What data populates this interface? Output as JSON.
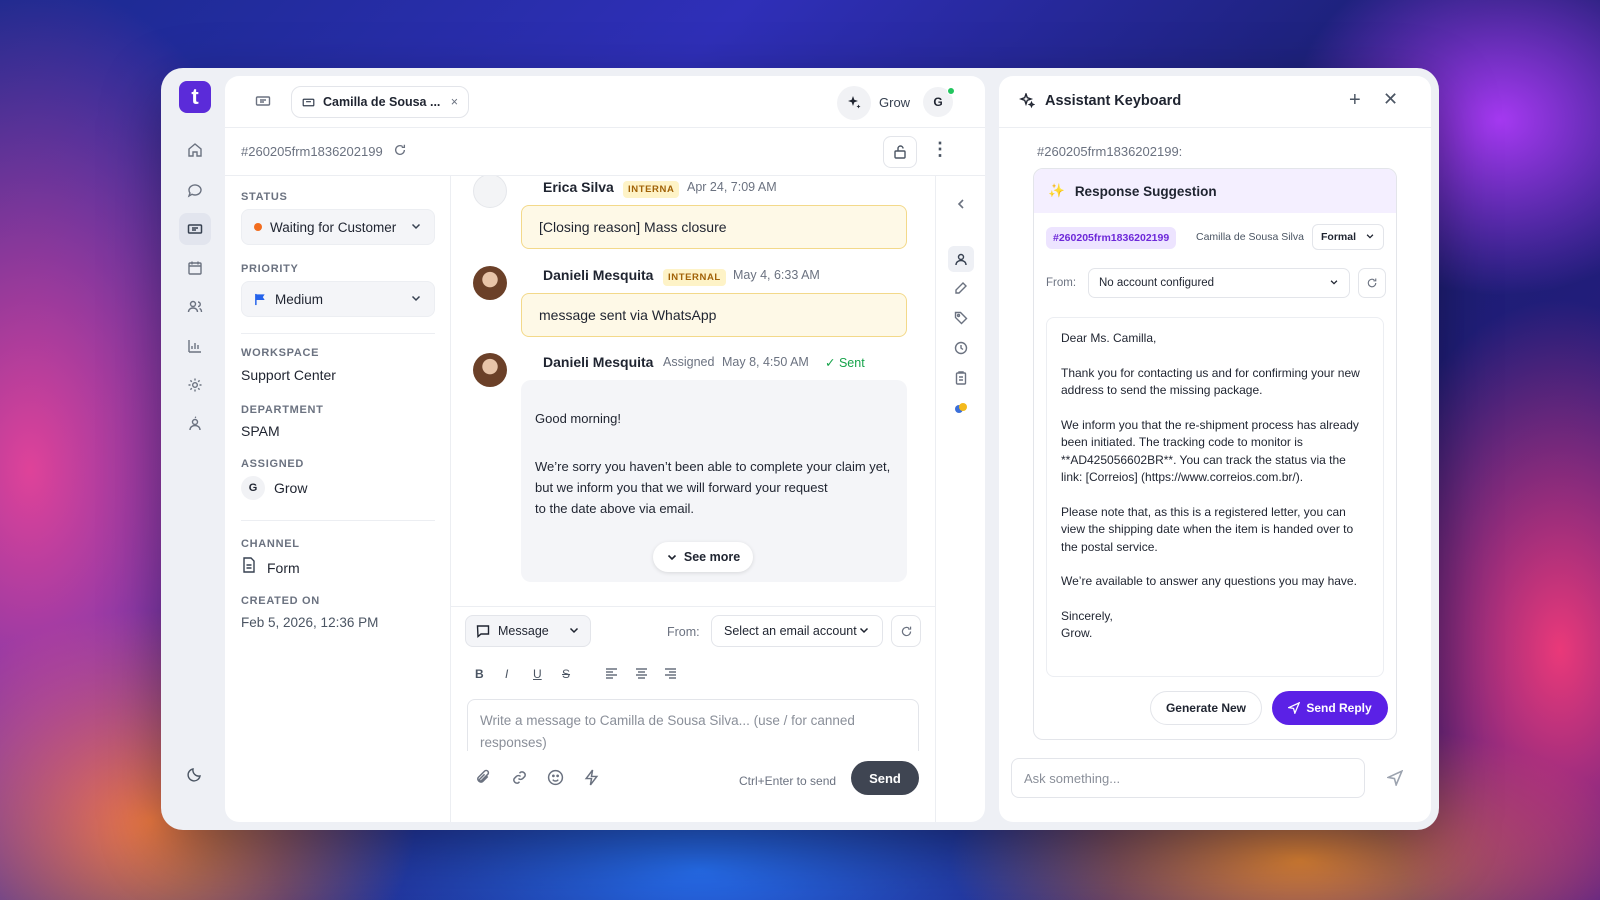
{
  "nav": {
    "logo": "t"
  },
  "tab": {
    "title": "Camilla de Sousa ...",
    "close": "×"
  },
  "header": {
    "user_name": "Grow",
    "user_initial": "G"
  },
  "ticket": {
    "id": "#260205frm1836202199"
  },
  "details": {
    "status_label": "STATUS",
    "status_value": "Waiting for Customer",
    "priority_label": "PRIORITY",
    "priority_value": "Medium",
    "workspace_label": "WORKSPACE",
    "workspace_value": "Support Center",
    "department_label": "DEPARTMENT",
    "department_value": "SPAM",
    "assigned_label": "ASSIGNED",
    "assigned_initial": "G",
    "assigned_value": "Grow",
    "channel_label": "CHANNEL",
    "channel_value": "Form",
    "created_label": "CREATED ON",
    "created_value": "Feb 5, 2026, 12:36 PM"
  },
  "messages": [
    {
      "author": "Erica Silva",
      "badge": "INTERNA",
      "time": "Apr 24, 7:09 AM",
      "text": "[Closing reason] Mass closure"
    },
    {
      "author": "Danieli Mesquita",
      "badge": "INTERNAL",
      "time": "May 4, 6:33 AM",
      "text": "message sent via WhatsApp"
    },
    {
      "author": "Danieli Mesquita",
      "assigned": "Assigned",
      "time": "May 8, 4:50 AM",
      "status": "Sent",
      "greeting": "Good morning!",
      "body_line1": "We’re sorry you haven’t been able to complete your claim yet,",
      "body_line2": "but we inform you that we will forward your request",
      "body_line3": "to the date above via email.",
      "see_more": "See more"
    }
  ],
  "composer": {
    "type": "Message",
    "from_label": "From:",
    "account": "Select an email account",
    "placeholder_line1": "Write a message to Camilla de Sousa Silva... (use / for canned",
    "placeholder_line2": "responses)",
    "hint": "Ctrl+Enter to send",
    "send": "Send",
    "format": {
      "bold": "B",
      "italic": "I",
      "underline": "U",
      "strike": "S"
    }
  },
  "assistant": {
    "title": "Assistant Keyboard",
    "ticket_ref": "#260205frm1836202199:",
    "card_title": "Response Suggestion",
    "chip": "#260205frm1836202199",
    "customer": "Camilla de Sousa Silva",
    "tone": "Formal",
    "from_label": "From:",
    "from_value": "No account configured",
    "reply": {
      "p1": "Dear Ms. Camilla,",
      "p2": "Thank you for contacting us and for confirming your new address to send the missing package.",
      "p3": "We inform you that the re-shipment process has already been initiated. The tracking code to monitor is **AD425056602BR**. You can track the status via the link: [Correios] (https://www.correios.com.br/).",
      "p4": "Please note that, as this is a registered letter, you can view the shipping date when the item is handed over to the postal service.",
      "p5": "We’re available to answer any questions you may have.",
      "p6a": "Sincerely,",
      "p6b": "Grow."
    },
    "generate": "Generate New",
    "send_reply": "Send Reply",
    "ask_placeholder": "Ask something..."
  }
}
